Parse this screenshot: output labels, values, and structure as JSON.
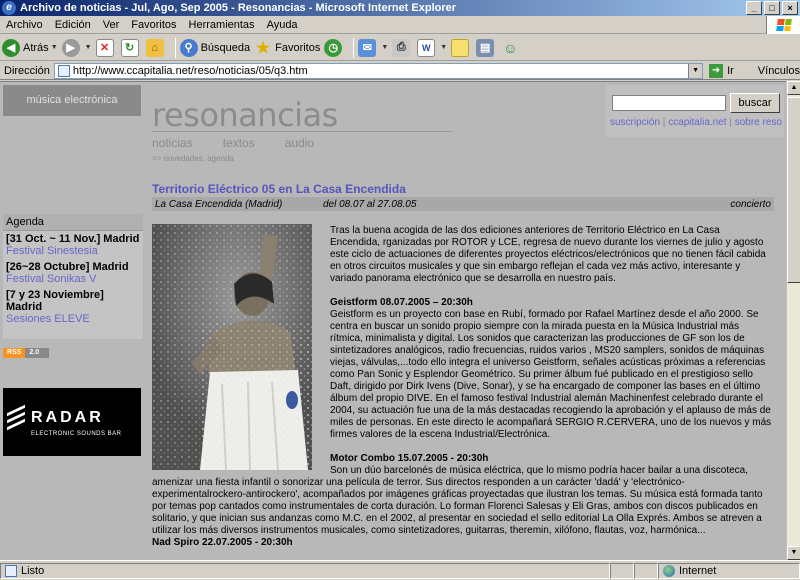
{
  "window": {
    "title": "Archivo de noticias - Jul, Ago, Sep 2005 - Resonancias - Microsoft Internet Explorer"
  },
  "menu": [
    "Archivo",
    "Edición",
    "Ver",
    "Favoritos",
    "Herramientas",
    "Ayuda"
  ],
  "toolbar": {
    "back": "Atrás",
    "search": "Búsqueda",
    "favorites": "Favoritos"
  },
  "address": {
    "label": "Dirección",
    "url": "http://www.ccapitalia.net/reso/noticias/05/q3.htm",
    "go": "Ir",
    "links": "Vínculos"
  },
  "status": {
    "text": "Listo",
    "zone": "Internet"
  },
  "page": {
    "section": "música electrónica",
    "site_title": "resonancias",
    "nav": [
      "noticias",
      "textos",
      "audio"
    ],
    "breadcrumb": ">> novedades, agenda",
    "search_button": "buscar",
    "top_links": [
      "suscripción",
      "ccapitalia.net",
      "sobre reso"
    ],
    "agenda": {
      "heading": "Agenda",
      "items": [
        {
          "date": "[31 Oct. ~ 11 Nov.] Madrid",
          "event": "Festival Sinestesia"
        },
        {
          "date": "[26~28 Octubre] Madrid",
          "event": "Festival Sonikas V"
        },
        {
          "date": "[7 y 23 Noviembre] Madrid",
          "event": "Sesiones ELEVE"
        }
      ]
    },
    "rss": {
      "a": "RSS",
      "b": "2.0"
    },
    "radar": {
      "name": "RADAR",
      "sub": "ELECTRONIC SOUNDS BAR"
    },
    "article": {
      "title": "Territorio Eléctrico 05 en La Casa Encendida",
      "venue": "La Casa Encendida (Madrid)",
      "dates": "del 08.07 al 27.08.05",
      "type": "concierto",
      "intro": "Tras la buena acogida de las dos ediciones anteriores de Territorio Eléctrico en La Casa Encendida, rganizadas por ROTOR y LCE, regresa de nuevo durante los viernes de julio y agosto este ciclo de actuaciones de diferentes proyectos eléctricos/electrónicos que no tienen fácil cabida en otros circuitos musicales y que sin embargo reflejan el cada vez más activo, interesante y variado panorama electrónico que se desarrolla en nuestro país.",
      "s1_title": "Geistform 08.07.2005 – 20:30h",
      "s1_text": "Geistform es un proyecto con base en Rubí, formado por Rafael Martínez desde el año 2000. Se centra en buscar un sonido propio siempre con la mirada puesta en la Música Industrial más rítmica, minimalista y digital. Los sonidos que caracterizan las producciones de GF son los de sintetizadores analógicos, radio frecuencias, ruidos varios , MS20 samplers, sonidos de máquinas viejas, válvulas,...todo ello integra el universo Geistform, señales acústicas próximas a referencias como Pan Sonic y Esplendor Geométrico. Su primer álbum fué publicado en el prestigioso sello Daft, dirigido por Dirk Ivens (Dive, Sonar), y se ha encargado de componer las bases en el último álbum del propio DIVE. En el famoso festival Industrial alemán Machinenfest celebrado durante el 2004, su actuación fue una de la más destacadas recogiendo la aprobación y el aplauso de más de miles de personas. En este directo le acompañará SERGIO R.CERVERA, uno de los nuevos y más firmes valores de la escena Industrial/Electrónica.",
      "s2_title": "Motor Combo 15.07.2005 - 20:30h",
      "s2_text_a": "Son un dúo barcelonés de música eléctrica, que lo mismo podría hacer bailar a una discoteca,",
      "s2_text_b": "amenizar una fiesta infantil o sonorizar una película de terror. Sus directos responden a un carácter 'dadá' y 'electrónico-experimentalrockero-antirockero', acompañados por imágenes gráficas proyectadas que ilustran los temas. Su música está formada tanto por temas pop cantados como instrumentales de corta duración. Lo forman Florenci Salesas y Eli Gras, ambos con discos publicados en solitario, y que inician sus andanzas como M.C. en el 2002, al presentar en sociedad el sello editorial La Olla Exprés. Ambos se atreven a utilizar los más diversos instrumentos musicales, como sintetizadores, guitarras, theremin, xilófono, flautas, voz, harmónica...",
      "s3_title": "Nad Spiro 22.07.2005 - 20:30h"
    }
  }
}
